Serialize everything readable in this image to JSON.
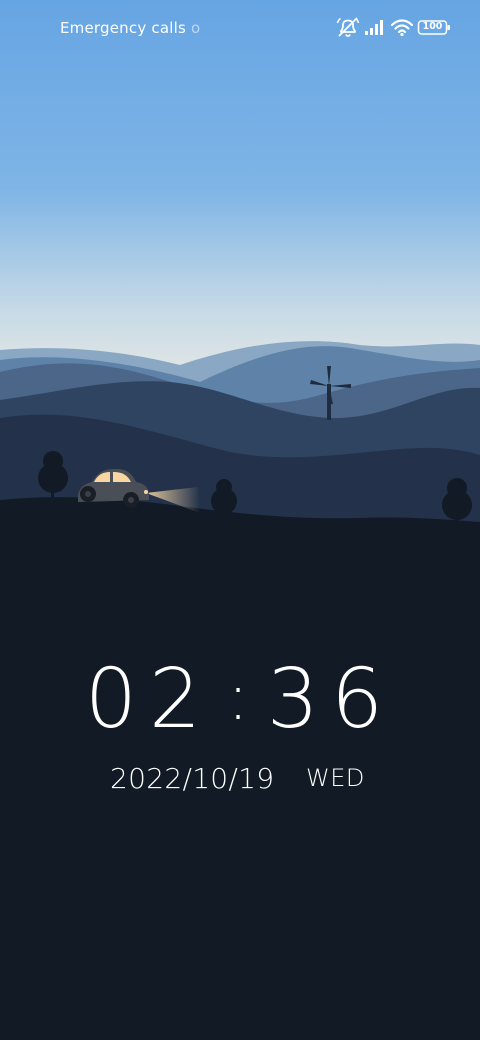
{
  "status_bar": {
    "carrier_text": "Emergency calls",
    "carrier_overflow": "o",
    "battery_level": "100",
    "icons": [
      "mute-icon",
      "signal-icon",
      "wifi-icon",
      "battery-icon"
    ]
  },
  "lock_screen": {
    "time": {
      "hours": "02",
      "separator": ":",
      "minutes": "36"
    },
    "date": "2022/10/19",
    "weekday": "WED"
  },
  "colors": {
    "sky_top": "#6aa7e2",
    "sky_horizon": "#f2efe6",
    "ground": "#111a25",
    "text": "#ffffff",
    "headlight": "#f6d6a6"
  }
}
